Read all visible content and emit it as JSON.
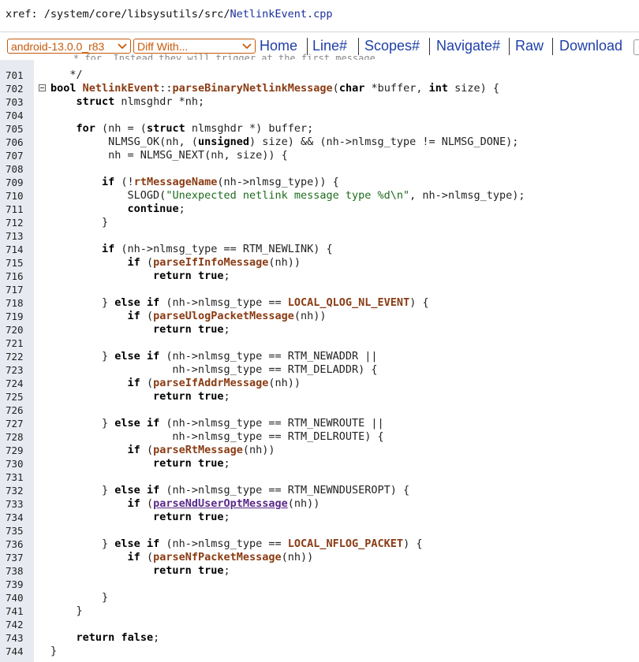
{
  "breadcrumb": {
    "prefix": "xref: /system/core/libsysutils/src/",
    "file": "NetlinkEvent.cpp"
  },
  "toolbar": {
    "branch_select": "android-13.0.0_r83",
    "diff_select": "Diff With...",
    "links": [
      "Home",
      "Line#",
      "Scopes#",
      "Navigate#",
      "Raw",
      "Download"
    ]
  },
  "colors": {
    "accent": "#c75a0c",
    "link": "#1f3fa8",
    "gutter": "#e7ebf1"
  },
  "code": {
    "cut_line": "    * for. Instead they will trigger at the first message.",
    "lines": [
      {
        "n": "701",
        "t": "   */"
      },
      {
        "n": "702",
        "t": "bool NetlinkEvent::parseBinaryNetlinkMessage(char *buffer, int size) {",
        "fold": true
      },
      {
        "n": "703",
        "t": "    struct nlmsghdr *nh;"
      },
      {
        "n": "704",
        "t": ""
      },
      {
        "n": "705",
        "t": "    for (nh = (struct nlmsghdr *) buffer;"
      },
      {
        "n": "706",
        "t": "         NLMSG_OK(nh, (unsigned) size) && (nh->nlmsg_type != NLMSG_DONE);"
      },
      {
        "n": "707",
        "t": "         nh = NLMSG_NEXT(nh, size)) {"
      },
      {
        "n": "708",
        "t": ""
      },
      {
        "n": "709",
        "t": "        if (!rtMessageName(nh->nlmsg_type)) {"
      },
      {
        "n": "710",
        "t": "            SLOGD(\"Unexpected netlink message type %d\\n\", nh->nlmsg_type);"
      },
      {
        "n": "711",
        "t": "            continue;"
      },
      {
        "n": "712",
        "t": "        }"
      },
      {
        "n": "713",
        "t": ""
      },
      {
        "n": "714",
        "t": "        if (nh->nlmsg_type == RTM_NEWLINK) {"
      },
      {
        "n": "715",
        "t": "            if (parseIfInfoMessage(nh))"
      },
      {
        "n": "716",
        "t": "                return true;"
      },
      {
        "n": "717",
        "t": ""
      },
      {
        "n": "718",
        "t": "        } else if (nh->nlmsg_type == LOCAL_QLOG_NL_EVENT) {"
      },
      {
        "n": "719",
        "t": "            if (parseUlogPacketMessage(nh))"
      },
      {
        "n": "720",
        "t": "                return true;"
      },
      {
        "n": "721",
        "t": ""
      },
      {
        "n": "722",
        "t": "        } else if (nh->nlmsg_type == RTM_NEWADDR ||"
      },
      {
        "n": "723",
        "t": "                   nh->nlmsg_type == RTM_DELADDR) {"
      },
      {
        "n": "724",
        "t": "            if (parseIfAddrMessage(nh))"
      },
      {
        "n": "725",
        "t": "                return true;"
      },
      {
        "n": "726",
        "t": ""
      },
      {
        "n": "727",
        "t": "        } else if (nh->nlmsg_type == RTM_NEWROUTE ||"
      },
      {
        "n": "728",
        "t": "                   nh->nlmsg_type == RTM_DELROUTE) {"
      },
      {
        "n": "729",
        "t": "            if (parseRtMessage(nh))"
      },
      {
        "n": "730",
        "t": "                return true;"
      },
      {
        "n": "731",
        "t": ""
      },
      {
        "n": "732",
        "t": "        } else if (nh->nlmsg_type == RTM_NEWNDUSEROPT) {"
      },
      {
        "n": "733",
        "t": "            if (parseNdUserOptMessage(nh))"
      },
      {
        "n": "734",
        "t": "                return true;"
      },
      {
        "n": "735",
        "t": ""
      },
      {
        "n": "736",
        "t": "        } else if (nh->nlmsg_type == LOCAL_NFLOG_PACKET) {"
      },
      {
        "n": "737",
        "t": "            if (parseNfPacketMessage(nh))"
      },
      {
        "n": "738",
        "t": "                return true;"
      },
      {
        "n": "739",
        "t": ""
      },
      {
        "n": "740",
        "t": "        }"
      },
      {
        "n": "741",
        "t": "    }"
      },
      {
        "n": "742",
        "t": ""
      },
      {
        "n": "743",
        "t": "    return false;"
      },
      {
        "n": "744",
        "t": "}"
      }
    ]
  }
}
